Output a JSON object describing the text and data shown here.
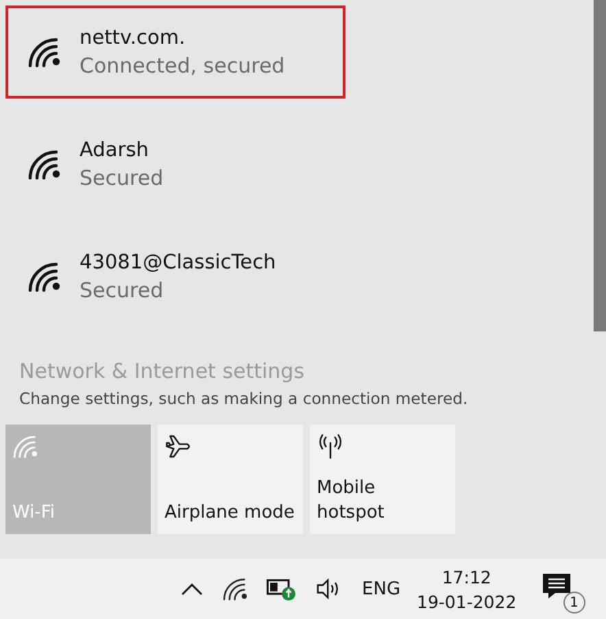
{
  "networks": [
    {
      "name": "nettv.com.",
      "status": "Connected, secured",
      "highlighted": true
    },
    {
      "name": "Adarsh",
      "status": "Secured",
      "highlighted": false
    },
    {
      "name": "43081@ClassicTech",
      "status": "Secured",
      "highlighted": false
    }
  ],
  "settings": {
    "title": "Network & Internet settings",
    "description": "Change settings, such as making a connection metered."
  },
  "quick_actions": [
    {
      "kind": "wifi",
      "label": "Wi-Fi",
      "on": true
    },
    {
      "kind": "airplane",
      "label": "Airplane mode",
      "on": false
    },
    {
      "kind": "hotspot",
      "label": "Mobile hotspot",
      "on": false
    }
  ],
  "taskbar": {
    "language": "ENG",
    "time": "17:12",
    "date": "19-01-2022",
    "notification_count": "1"
  }
}
